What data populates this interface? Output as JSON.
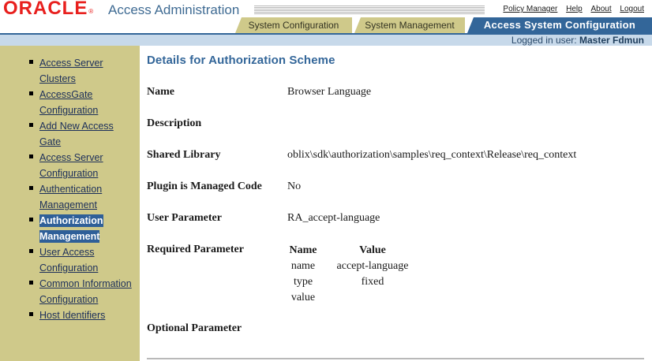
{
  "header": {
    "logo_text": "ORACLE",
    "logo_mark": "®",
    "app_title": "Access Administration",
    "links": [
      "Policy Manager",
      "Help",
      "About",
      "Logout"
    ],
    "tabs": [
      {
        "label": "System Configuration",
        "active": false
      },
      {
        "label": "System Management",
        "active": false
      },
      {
        "label": "Access System Configuration",
        "active": true
      }
    ],
    "logged_in_label": "Logged in user:",
    "logged_in_user": "Master Fdmun"
  },
  "sidebar": {
    "items": [
      {
        "line1": "Access Server",
        "line2": "Clusters",
        "selected": false
      },
      {
        "line1": "AccessGate",
        "line2": "Configuration",
        "selected": false
      },
      {
        "line1": "Add New Access",
        "line2": "Gate",
        "selected": false
      },
      {
        "line1": "Access Server",
        "line2": "Configuration",
        "selected": false
      },
      {
        "line1": "Authentication",
        "line2": "Management",
        "selected": false
      },
      {
        "line1": "Authorization",
        "line2": "Management",
        "selected": true
      },
      {
        "line1": "User Access",
        "line2": "Configuration",
        "selected": false
      },
      {
        "line1": "Common Information",
        "line2": "Configuration",
        "selected": false
      },
      {
        "line1": "Host Identifiers",
        "line2": "",
        "selected": false
      }
    ]
  },
  "main": {
    "title": "Details for Authorization Scheme",
    "fields": {
      "name": {
        "label": "Name",
        "value": "Browser Language"
      },
      "description": {
        "label": "Description",
        "value": ""
      },
      "shared_library": {
        "label": "Shared Library",
        "value": "oblix\\sdk\\authorization\\samples\\req_context\\Release\\req_context"
      },
      "managed_code": {
        "label": "Plugin is Managed Code",
        "value": "No"
      },
      "user_parameter": {
        "label": "User Parameter",
        "value": "RA_accept-language"
      },
      "required_parameter": {
        "label": "Required Parameter"
      },
      "optional_parameter": {
        "label": "Optional Parameter"
      }
    },
    "required_table": {
      "headers": [
        "Name",
        "Value"
      ],
      "rows": [
        [
          "name",
          "accept-language"
        ],
        [
          "type",
          "fixed"
        ],
        [
          "value",
          ""
        ]
      ]
    }
  },
  "colors": {
    "accent": "#336699",
    "sidebar_bg": "#cfc98a",
    "logo_red": "#e8201e",
    "userbar_bg": "#c7d9ea"
  }
}
